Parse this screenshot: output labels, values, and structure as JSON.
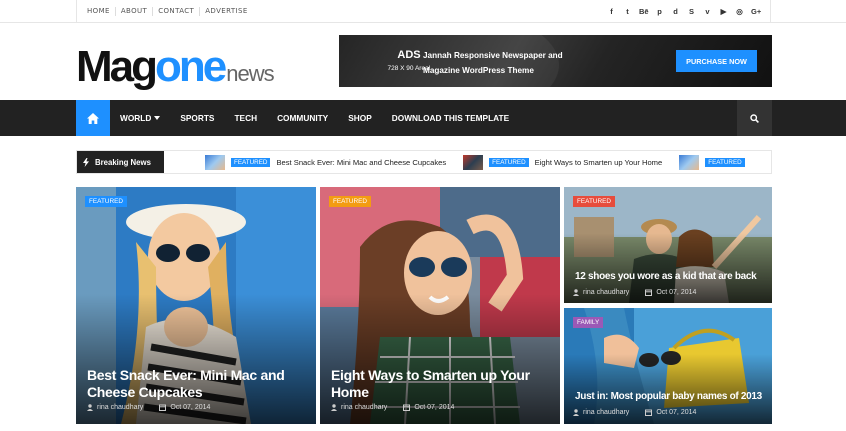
{
  "topbar": {
    "links": [
      "HOME",
      "ABOUT",
      "CONTACT",
      "ADVERTISE"
    ],
    "social_icons": [
      {
        "name": "facebook-icon",
        "glyph": "f"
      },
      {
        "name": "twitter-icon",
        "glyph": "t"
      },
      {
        "name": "behance-icon",
        "glyph": "Bē"
      },
      {
        "name": "pinterest-icon",
        "glyph": "p"
      },
      {
        "name": "digg-icon",
        "glyph": "d"
      },
      {
        "name": "skype-icon",
        "glyph": "S"
      },
      {
        "name": "vimeo-icon",
        "glyph": "v"
      },
      {
        "name": "youtube-icon",
        "glyph": "▶"
      },
      {
        "name": "instagram-icon",
        "glyph": "◎"
      },
      {
        "name": "google-plus-icon",
        "glyph": "G+"
      }
    ]
  },
  "logo": {
    "part1": "Mag",
    "part2": "one",
    "part3": "news"
  },
  "ad": {
    "title": "ADS",
    "size": "728 X 90 Area!",
    "text": "Jannah Responsive Newspaper and Magazine WordPress Theme",
    "button": "PURCHASE NOW"
  },
  "nav": {
    "items": [
      "WORLD",
      "SPORTS",
      "TECH",
      "COMMUNITY",
      "SHOP",
      "DOWNLOAD THIS TEMPLATE"
    ]
  },
  "breaking": {
    "label": "Breaking News",
    "items": [
      {
        "badge": "FEATURED",
        "title": "Best Snack Ever: Mini Mac and Cheese Cupcakes"
      },
      {
        "badge": "FEATURED",
        "title": "Eight Ways to Smarten up Your Home"
      },
      {
        "badge": "FEATURED",
        "title": ""
      }
    ]
  },
  "cards": [
    {
      "badge": "FEATURED",
      "title": "Best Snack Ever: Mini Mac and Cheese Cupcakes",
      "author": "rina chaudhary",
      "date": "Oct 07, 2014"
    },
    {
      "badge": "FEATURED",
      "title": "Eight Ways to Smarten up Your Home",
      "author": "rina chaudhary",
      "date": "Oct 07, 2014"
    },
    {
      "badge": "FEATURED",
      "title": "12 shoes you wore as a kid that are back",
      "author": "rina chaudhary",
      "date": "Oct 07, 2014"
    },
    {
      "badge": "FAMILY",
      "title": "Just in: Most popular baby names of 2013",
      "author": "rina chaudhary",
      "date": "Oct 07, 2014"
    }
  ],
  "colors": {
    "accent": "#1e90ff",
    "featured_blue": "#1e90ff",
    "featured_orange": "#f39c12",
    "featured_red": "#e74c3c",
    "family_purple": "#9b59b6",
    "nav_bg": "#222222"
  }
}
